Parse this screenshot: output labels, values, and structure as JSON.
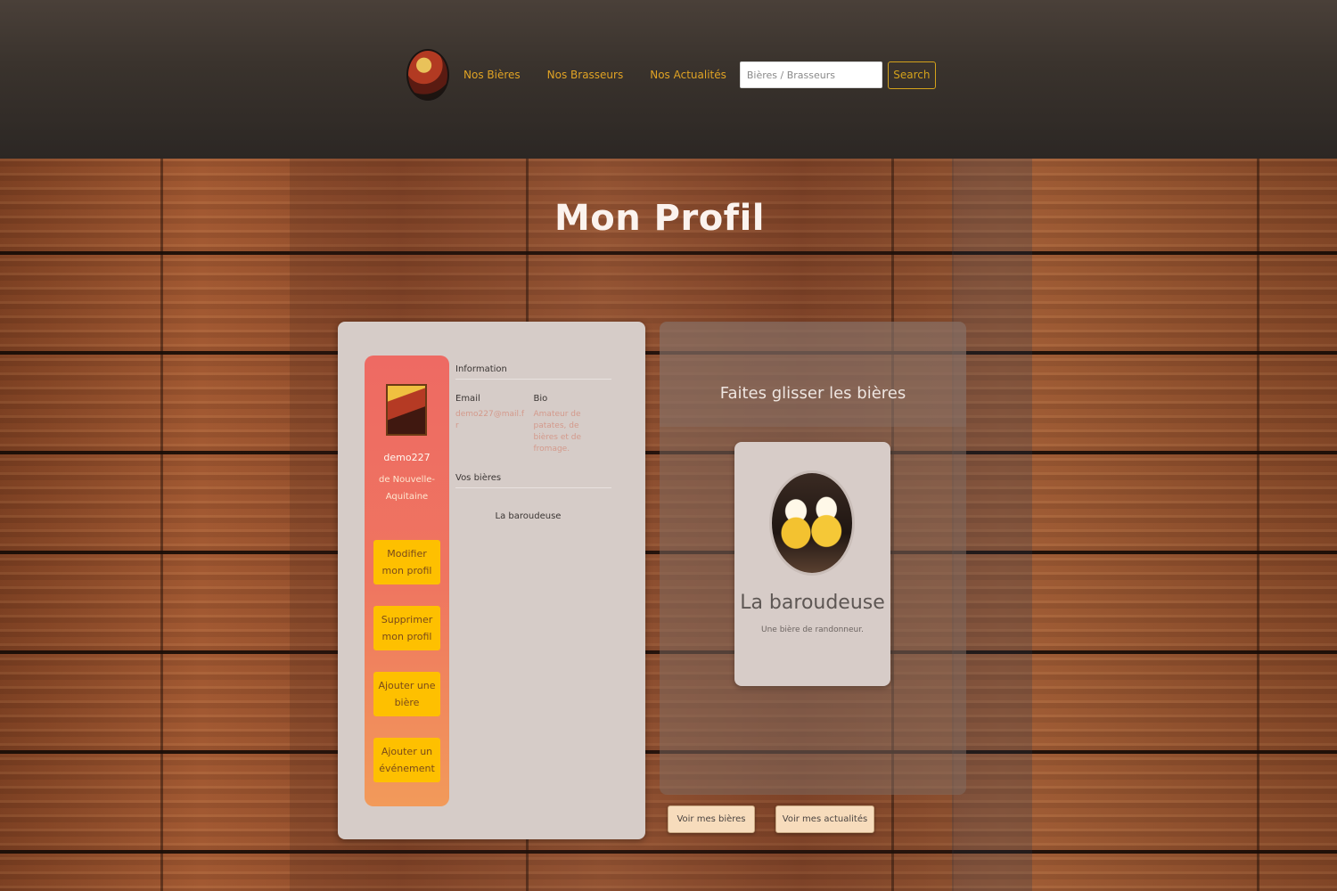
{
  "header": {
    "nav": [
      "Nos Bières",
      "Nos Brasseurs",
      "Nos Actualités"
    ],
    "search": {
      "placeholder": "Bières / Brasseurs",
      "button_label": "Search"
    }
  },
  "page_title": "Mon Profil",
  "profile": {
    "username": "demo227",
    "region": "de Nouvelle-Aquitaine",
    "buttons": {
      "edit": "Modifier mon profil",
      "delete": "Supprimer mon profil",
      "add_beer": "Ajouter une bière",
      "add_event": "Ajouter un événement"
    },
    "information_title": "Information",
    "email_label": "Email",
    "email_value": "demo227@mail.fr",
    "bio_label": "Bio",
    "bio_value": "Amateur de patates, de bières et de fromage.",
    "beers_title": "Vos bières",
    "beers": [
      "La baroudeuse"
    ]
  },
  "slider": {
    "title": "Faites glisser les bières",
    "card": {
      "name": "La baroudeuse",
      "description": "Une bière de randonneur."
    }
  },
  "actions": {
    "my_beers": "Voir mes bières",
    "my_news": "Voir mes actualités"
  },
  "colors": {
    "header_link": "#e0a324",
    "side_panel": "#ef7560",
    "side_button": "#fec000",
    "card_bg": "#d6ccc8",
    "action_button": "#f7dcbc"
  }
}
